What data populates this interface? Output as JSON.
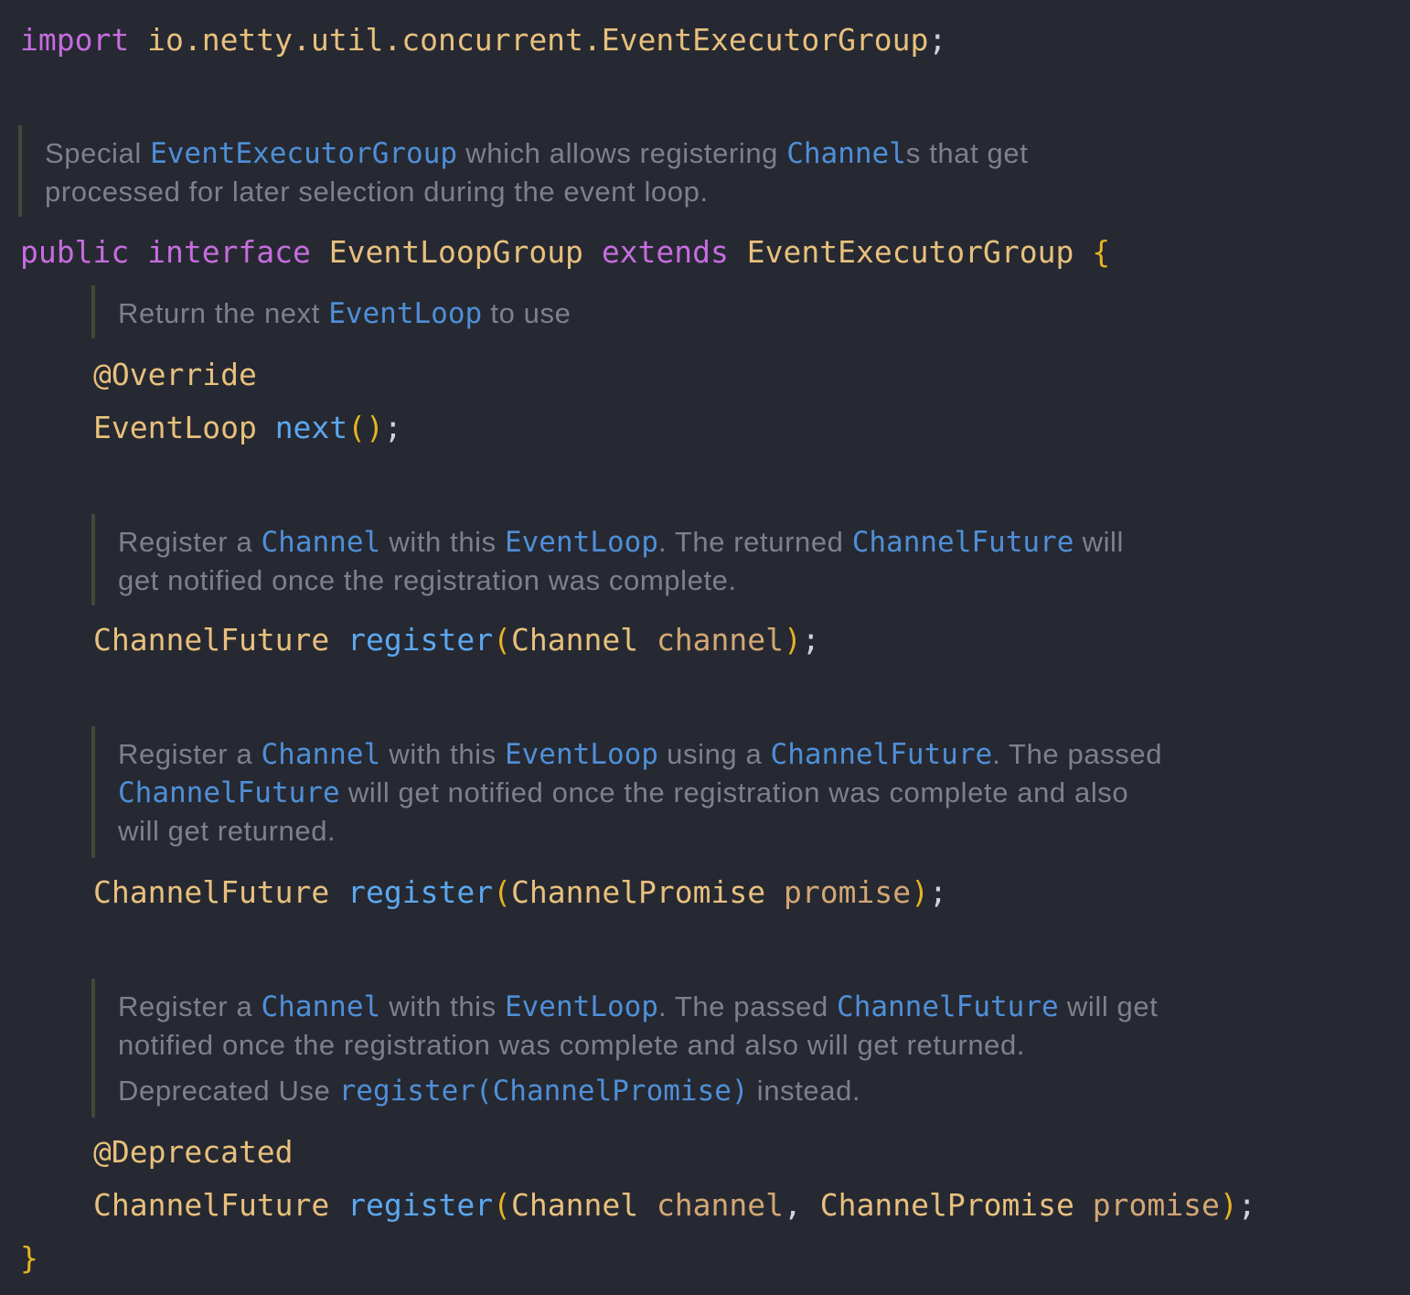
{
  "code": {
    "import_kw": "import",
    "import_path": "io.netty.util.concurrent.EventExecutorGroup",
    "semicolon": ";",
    "public_kw": "public",
    "interface_kw": "interface",
    "class_name": "EventLoopGroup",
    "extends_kw": "extends",
    "super_name": "EventExecutorGroup",
    "open_brace": "{",
    "close_brace": "}",
    "override_anno": "@Override",
    "next_ret": "EventLoop",
    "next_fn": "next",
    "empty_parens": "()",
    "future_type": "ChannelFuture",
    "register_fn": "register",
    "lparen": "(",
    "rparen": ")",
    "channel_type": "Channel",
    "channel_param": "channel",
    "promise_type": "ChannelPromise",
    "promise_param": "promise",
    "comma": ",",
    "deprecated_anno": "@Deprecated"
  },
  "docs": {
    "class_doc": {
      "l1_a": "Special ",
      "l1_ref1": "EventExecutorGroup",
      "l1_b": " which allows registering ",
      "l1_ref2": "Channel",
      "l1_c": "s that get",
      "l2": "processed for later selection during the event loop."
    },
    "next_doc": {
      "a": "Return the next ",
      "ref": "EventLoop",
      "b": " to use"
    },
    "reg1_doc": {
      "l1_a": "Register a ",
      "l1_ref1": "Channel",
      "l1_b": " with this ",
      "l1_ref2": "EventLoop",
      "l1_c": ". The returned ",
      "l1_ref3": "ChannelFuture",
      "l1_d": " will",
      "l2": "get notified once the registration was complete."
    },
    "reg2_doc": {
      "l1_a": "Register a ",
      "l1_ref1": "Channel",
      "l1_b": " with this ",
      "l1_ref2": "EventLoop",
      "l1_c": " using a ",
      "l1_ref3": "ChannelFuture",
      "l1_d": ". The passed",
      "l2_ref": "ChannelFuture",
      "l2_b": " will get notified once the registration was complete and also",
      "l3": "will get returned."
    },
    "reg3_doc": {
      "l1_a": "Register a ",
      "l1_ref1": "Channel",
      "l1_b": " with this ",
      "l1_ref2": "EventLoop",
      "l1_c": ". The passed ",
      "l1_ref3": "ChannelFuture",
      "l1_d": " will get",
      "l2": "notified once the registration was complete and also will get returned.",
      "l3_a": "Deprecated",
      "l3_b": " Use ",
      "l3_ref": "register(ChannelPromise)",
      "l3_c": " instead."
    }
  }
}
